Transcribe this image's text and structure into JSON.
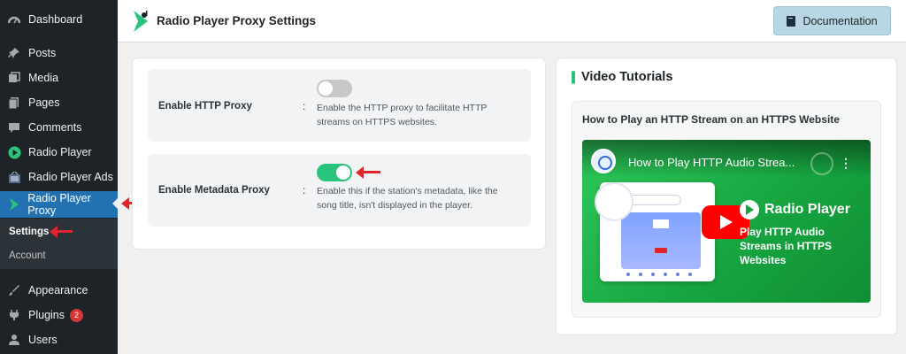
{
  "sidebar": {
    "items": [
      {
        "label": "Dashboard",
        "icon": "dashboard-icon"
      },
      {
        "label": "Posts",
        "icon": "pin-icon"
      },
      {
        "label": "Media",
        "icon": "media-icon"
      },
      {
        "label": "Pages",
        "icon": "pages-icon"
      },
      {
        "label": "Comments",
        "icon": "comment-icon"
      },
      {
        "label": "Radio Player",
        "icon": "radio-player-icon"
      },
      {
        "label": "Radio Player Ads",
        "icon": "ads-icon"
      },
      {
        "label": "Radio Player Proxy",
        "icon": "proxy-icon"
      },
      {
        "label": "Appearance",
        "icon": "brush-icon"
      },
      {
        "label": "Plugins",
        "icon": "plugin-icon",
        "badge": "2"
      },
      {
        "label": "Users",
        "icon": "user-icon"
      }
    ],
    "submenu": [
      {
        "label": "Settings"
      },
      {
        "label": "Account"
      }
    ]
  },
  "header": {
    "title": "Radio Player Proxy Settings",
    "documentation_label": "Documentation"
  },
  "settings": {
    "rows": [
      {
        "label": "Enable HTTP Proxy",
        "colon": ":",
        "enabled": false,
        "description": "Enable the HTTP proxy to facilitate HTTP streams on HTTPS websites."
      },
      {
        "label": "Enable Metadata Proxy",
        "colon": ":",
        "enabled": true,
        "description": "Enable this if the station's metadata, like the song title, isn't displayed in the player."
      }
    ]
  },
  "tutorials": {
    "title": "Video Tutorials",
    "video_heading": "How to Play an HTTP Stream on an HTTPS Website",
    "video_overlay_title": "How to Play HTTP Audio Strea...",
    "brand_name": "Radio Player",
    "tagline": "Play HTTP Audio Streams in HTTPS Websites"
  },
  "colors": {
    "sidebar_bg": "#1d2327",
    "active_bg": "#2271b1",
    "toggle_on": "#2ac37b",
    "accent_arrow": "#e0242c",
    "youtube_red": "#ff0000"
  }
}
